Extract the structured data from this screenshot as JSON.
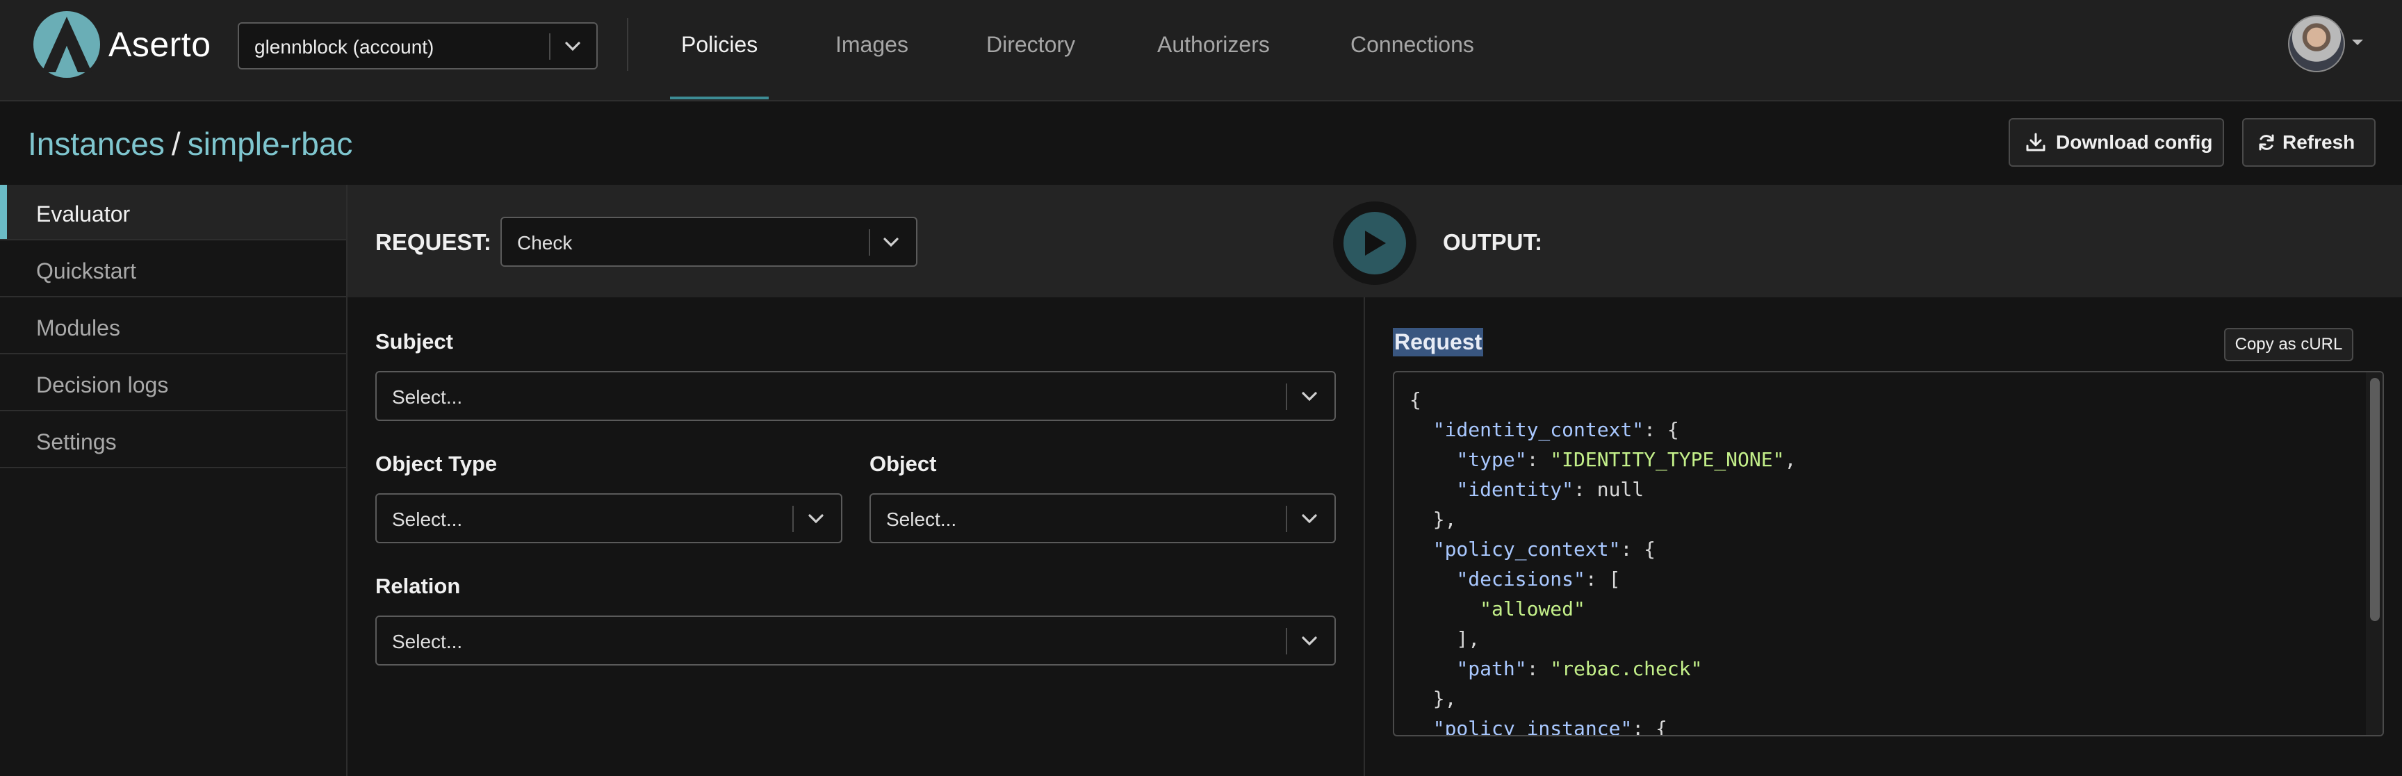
{
  "app": {
    "name": "Aserto"
  },
  "account_selector": {
    "value": "glennblock (account)"
  },
  "nav": {
    "items": [
      {
        "label": "Policies",
        "active": true
      },
      {
        "label": "Images"
      },
      {
        "label": "Directory"
      },
      {
        "label": "Authorizers"
      },
      {
        "label": "Connections"
      }
    ]
  },
  "breadcrumb": {
    "root": "Instances",
    "separator": "/",
    "current": "simple-rbac"
  },
  "actions": {
    "download": "Download config",
    "refresh": "Refresh"
  },
  "sidebar": {
    "items": [
      {
        "label": "Evaluator",
        "active": true
      },
      {
        "label": "Quickstart"
      },
      {
        "label": "Modules"
      },
      {
        "label": "Decision logs"
      },
      {
        "label": "Settings"
      }
    ]
  },
  "request_bar": {
    "request_label": "REQUEST:",
    "request_value": "Check",
    "output_label": "OUTPUT:"
  },
  "form": {
    "subject": {
      "label": "Subject",
      "placeholder": "Select..."
    },
    "object_type": {
      "label": "Object Type",
      "placeholder": "Select..."
    },
    "object": {
      "label": "Object",
      "placeholder": "Select..."
    },
    "relation": {
      "label": "Relation",
      "placeholder": "Select..."
    }
  },
  "output": {
    "title": "Request",
    "copy_curl": "Copy as cURL",
    "code_lines": [
      [
        {
          "t": "{"
        }
      ],
      [
        {
          "t": "  "
        },
        {
          "t": "\"identity_context\"",
          "c": "k"
        },
        {
          "t": ": {"
        }
      ],
      [
        {
          "t": "    "
        },
        {
          "t": "\"type\"",
          "c": "k"
        },
        {
          "t": ": "
        },
        {
          "t": "\"IDENTITY_TYPE_NONE\"",
          "c": "s"
        },
        {
          "t": ","
        }
      ],
      [
        {
          "t": "    "
        },
        {
          "t": "\"identity\"",
          "c": "k"
        },
        {
          "t": ": null"
        }
      ],
      [
        {
          "t": "  },"
        }
      ],
      [
        {
          "t": "  "
        },
        {
          "t": "\"policy_context\"",
          "c": "k"
        },
        {
          "t": ": {"
        }
      ],
      [
        {
          "t": "    "
        },
        {
          "t": "\"decisions\"",
          "c": "k"
        },
        {
          "t": ": ["
        }
      ],
      [
        {
          "t": "      "
        },
        {
          "t": "\"allowed\"",
          "c": "s"
        }
      ],
      [
        {
          "t": "    ],"
        }
      ],
      [
        {
          "t": "    "
        },
        {
          "t": "\"path\"",
          "c": "k"
        },
        {
          "t": ": "
        },
        {
          "t": "\"rebac.check\"",
          "c": "s"
        }
      ],
      [
        {
          "t": "  },"
        }
      ],
      [
        {
          "t": "  "
        },
        {
          "t": "\"policy_instance\"",
          "c": "k"
        },
        {
          "t": ": {"
        }
      ]
    ]
  },
  "colors": {
    "accent": "#3d8c95",
    "link": "#7fc6cf",
    "key": "#a9c8ff",
    "string": "#c4f08a"
  }
}
